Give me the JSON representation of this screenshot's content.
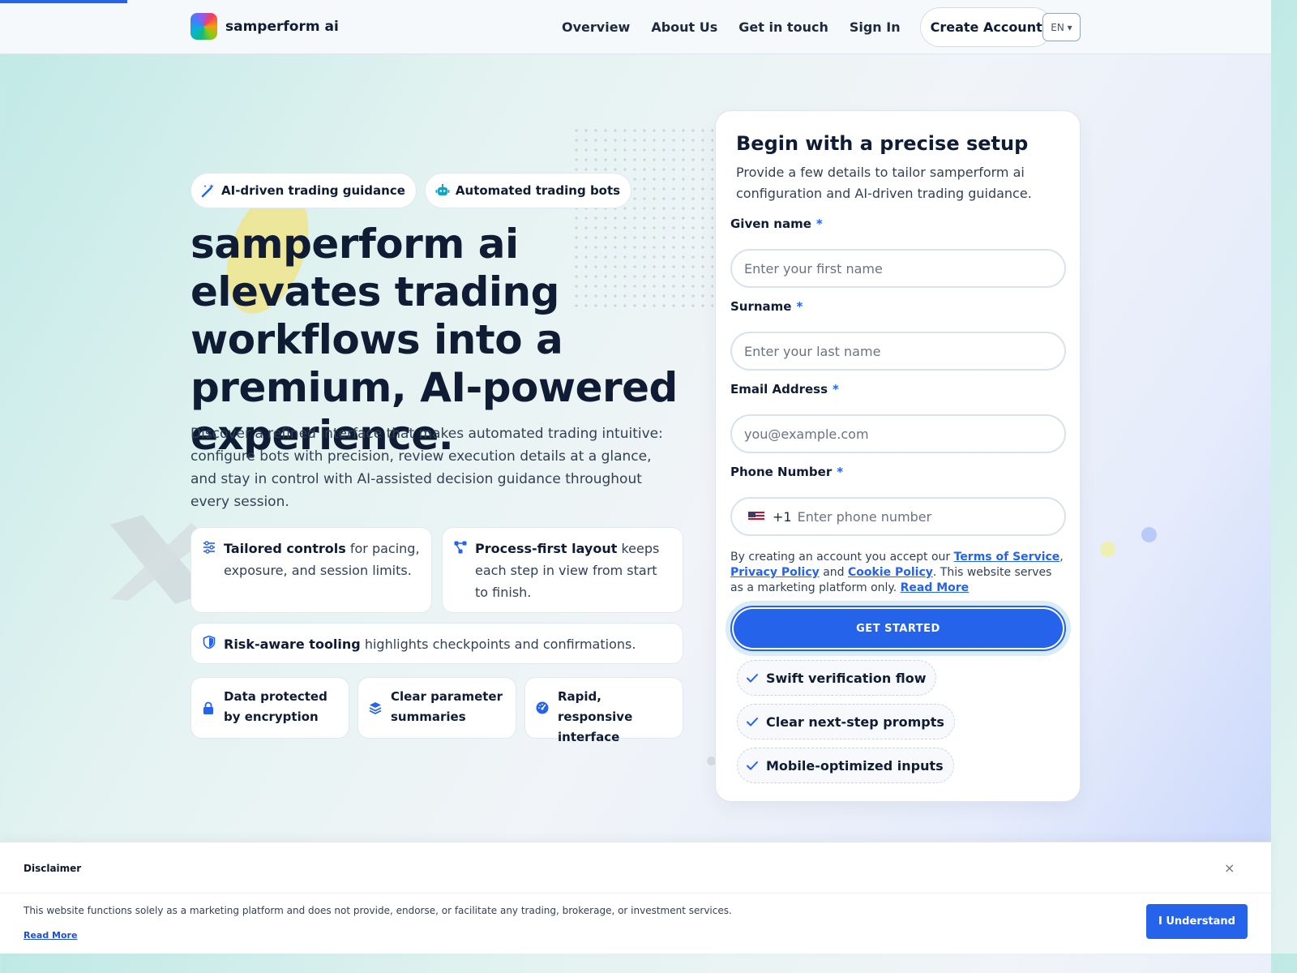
{
  "brand": {
    "name": "samperform ai"
  },
  "nav": {
    "items": [
      "Overview",
      "About Us",
      "Get in touch",
      "Sign In"
    ],
    "create": "Create Account",
    "lang": "EN ▾"
  },
  "hero": {
    "tags": [
      "AI-driven trading guidance",
      "Automated trading bots"
    ],
    "title": "samperform ai elevates trading workflows into a premium, AI-powered experience.",
    "lead": "Discover a refined interface that makes automated trading intuitive: configure bots with precision, review execution details at a glance, and stay in control with AI-assisted decision guidance throughout every session.",
    "features": [
      {
        "bold": "Tailored controls",
        "text": " for pacing, exposure, and session limits.",
        "icon": "sliders-icon"
      },
      {
        "bold": "Process-first layout",
        "text": " keeps each step in view from start to finish.",
        "icon": "flow-icon"
      },
      {
        "bold": "Risk-aware tooling",
        "text": " highlights checkpoints and confirmations.",
        "icon": "shield-icon"
      }
    ],
    "mini": [
      {
        "text": "Data protected by encryption",
        "icon": "lock-icon"
      },
      {
        "text": "Clear parameter summaries",
        "icon": "layers-icon"
      },
      {
        "text": "Rapid, responsive interface",
        "icon": "gauge-icon"
      }
    ]
  },
  "form": {
    "title": "Begin with a precise setup",
    "subtitle": "Provide a few details to tailor samperform ai configuration and AI-driven trading guidance.",
    "fields": [
      {
        "label": "Given name",
        "placeholder": "Enter your first name"
      },
      {
        "label": "Surname",
        "placeholder": "Enter your last name"
      },
      {
        "label": "Email Address",
        "placeholder": "you@example.com"
      },
      {
        "label": "Phone Number",
        "placeholder": "Enter phone number",
        "code": "+1"
      }
    ],
    "required_mark": "*",
    "terms": {
      "pre": "By creating an account you accept our ",
      "tos": "Terms of Service",
      "comma": ",",
      "privacy": "Privacy Policy",
      "and": " and ",
      "cookie": "Cookie Policy",
      "post": ". This website serves as a marketing platform only. ",
      "more": "Read More"
    },
    "cta": "GET STARTED",
    "checks": [
      "Swift verification flow",
      "Clear next-step prompts",
      "Mobile-optimized inputs"
    ]
  },
  "disclaimer": {
    "title": "Disclaimer",
    "close": "×",
    "text": "This website functions solely as a marketing platform and does not provide, endorse, or facilitate any trading, brokerage, or investment services.",
    "link": "Read More",
    "button": "I Understand"
  },
  "colors": {
    "accent": "#2563eb",
    "ink": "#0f1c33",
    "yellow": "#eee58b"
  }
}
